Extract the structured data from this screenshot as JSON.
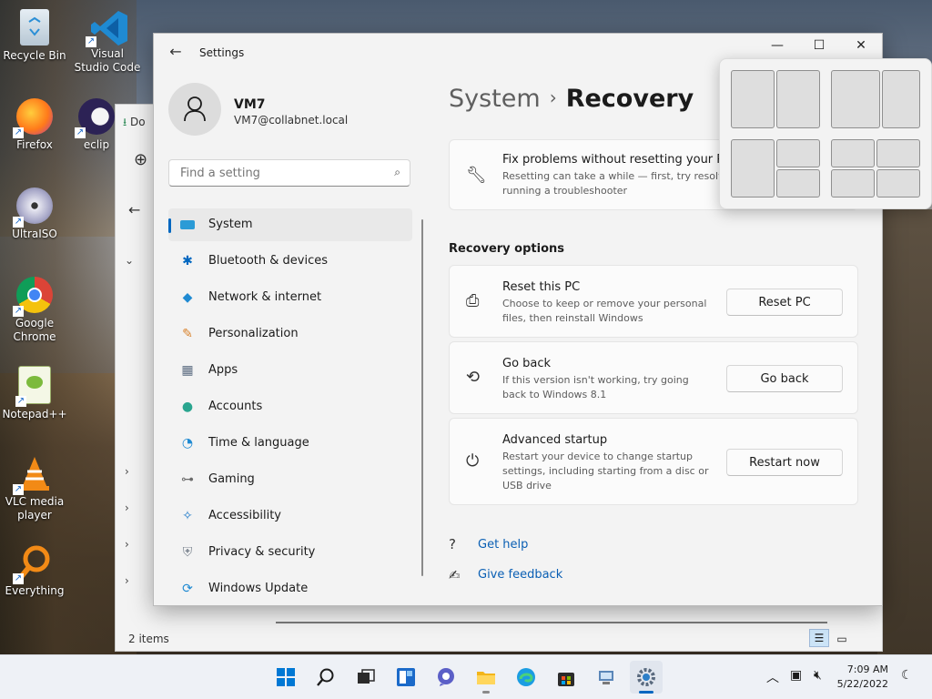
{
  "desktop": {
    "icons": [
      {
        "label": "Recycle Bin",
        "icon": "recycle-bin-icon"
      },
      {
        "label": "Visual Studio Code",
        "icon": "vscode-icon"
      },
      {
        "label": "Firefox",
        "icon": "firefox-icon"
      },
      {
        "label": "eclip",
        "icon": "eclipse-icon"
      },
      {
        "label": "UltraISO",
        "icon": "ultraiso-icon"
      },
      {
        "label": "Google Chrome",
        "icon": "chrome-icon"
      },
      {
        "label": "Notepad++",
        "icon": "notepadpp-icon"
      },
      {
        "label": "VLC media player",
        "icon": "vlc-icon"
      },
      {
        "label": "Everything",
        "icon": "everything-icon"
      }
    ]
  },
  "explorer": {
    "tab_fragment": "Do",
    "status": "2 items"
  },
  "settings": {
    "window_title": "Settings",
    "user": {
      "name": "VM7",
      "email": "VM7@collabnet.local"
    },
    "search_placeholder": "Find a setting",
    "nav": [
      {
        "label": "System",
        "icon": "system-icon",
        "active": true
      },
      {
        "label": "Bluetooth & devices",
        "icon": "bluetooth-icon"
      },
      {
        "label": "Network & internet",
        "icon": "network-icon"
      },
      {
        "label": "Personalization",
        "icon": "brush-icon"
      },
      {
        "label": "Apps",
        "icon": "apps-icon"
      },
      {
        "label": "Accounts",
        "icon": "accounts-icon"
      },
      {
        "label": "Time & language",
        "icon": "time-icon"
      },
      {
        "label": "Gaming",
        "icon": "gaming-icon"
      },
      {
        "label": "Accessibility",
        "icon": "accessibility-icon"
      },
      {
        "label": "Privacy & security",
        "icon": "shield-icon"
      },
      {
        "label": "Windows Update",
        "icon": "update-icon"
      }
    ],
    "breadcrumb": {
      "parent": "System",
      "separator": "›",
      "current": "Recovery"
    },
    "fix_card": {
      "title": "Fix problems without resetting your PC",
      "desc": "Resetting can take a while — first, try resolving issues by running a troubleshooter"
    },
    "recovery_options_label": "Recovery options",
    "options": [
      {
        "title": "Reset this PC",
        "desc": "Choose to keep or remove your personal files, then reinstall Windows",
        "button": "Reset PC",
        "icon": "reset-icon"
      },
      {
        "title": "Go back",
        "desc": "If this version isn't working, try going back to Windows 8.1",
        "button": "Go back",
        "icon": "history-icon"
      },
      {
        "title": "Advanced startup",
        "desc": "Restart your device to change startup settings, including starting from a disc or USB drive",
        "button": "Restart now",
        "icon": "advanced-startup-icon"
      }
    ],
    "links": {
      "help": "Get help",
      "feedback": "Give feedback"
    }
  },
  "taskbar": {
    "apps": [
      "start",
      "search",
      "task-view",
      "widgets",
      "teams-chat",
      "file-explorer",
      "edge",
      "store",
      "remote-desktop",
      "settings"
    ],
    "time": "7:09 AM",
    "date": "5/22/2022"
  },
  "colors": {
    "accent": "#0067c0",
    "link": "#0a5fb4"
  }
}
